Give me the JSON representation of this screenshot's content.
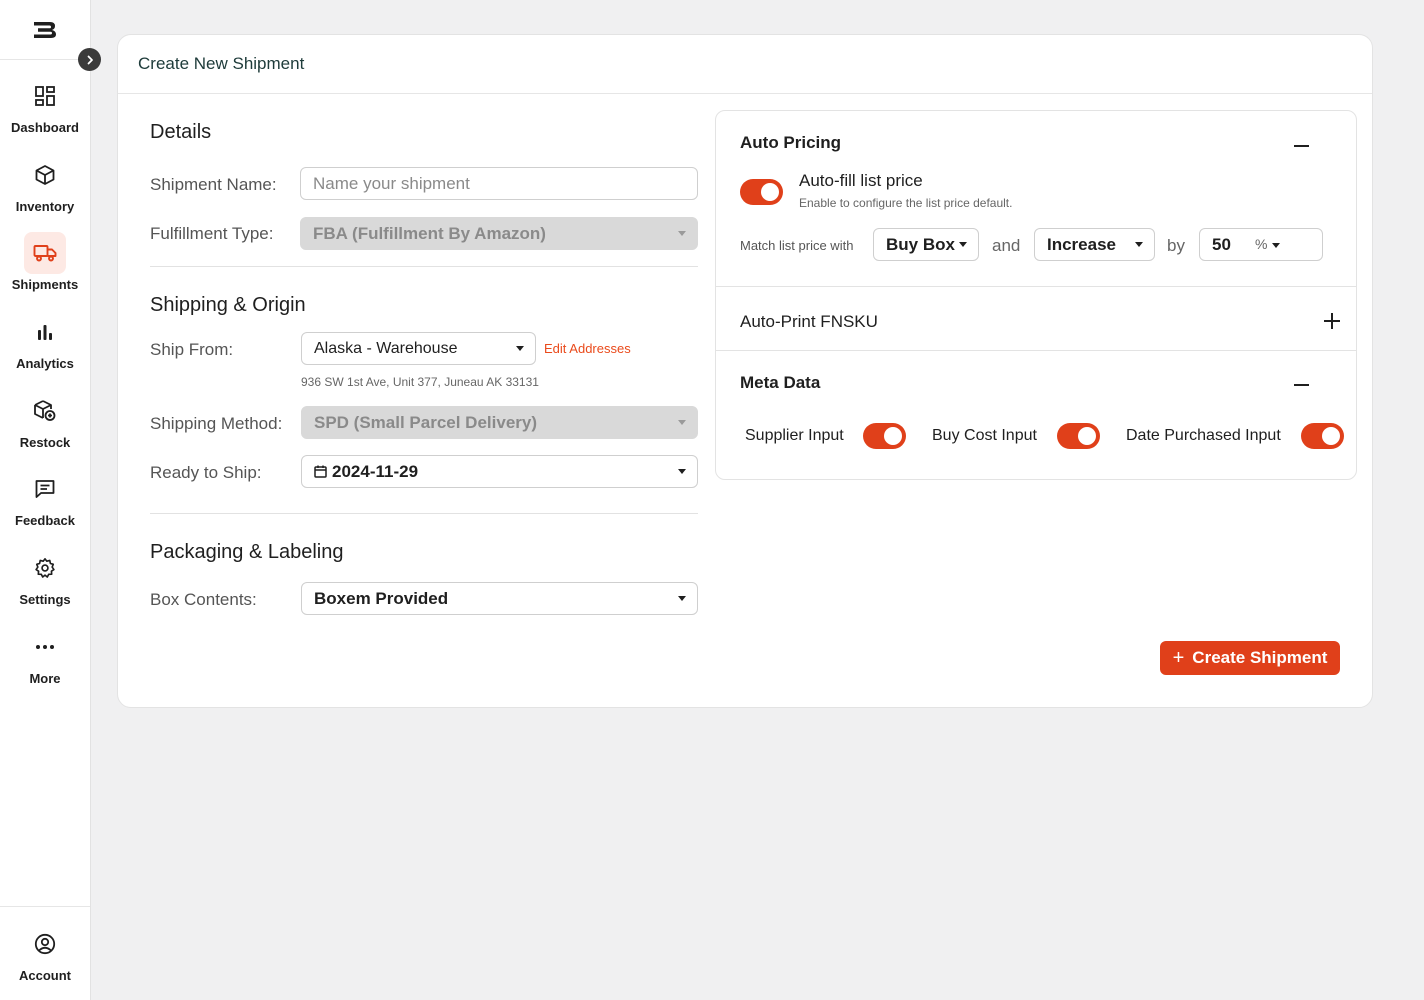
{
  "sidebar": {
    "logo": "B",
    "items": [
      {
        "label": "Dashboard",
        "icon": "dashboard-icon"
      },
      {
        "label": "Inventory",
        "icon": "box-icon"
      },
      {
        "label": "Shipments",
        "icon": "truck-icon"
      },
      {
        "label": "Analytics",
        "icon": "bar-chart-icon"
      },
      {
        "label": "Restock",
        "icon": "restock-icon"
      },
      {
        "label": "Feedback",
        "icon": "message-icon"
      },
      {
        "label": "Settings",
        "icon": "gear-icon"
      },
      {
        "label": "More",
        "icon": "more-icon"
      }
    ],
    "account": {
      "label": "Account",
      "icon": "user-circle-icon"
    },
    "active": "Shipments"
  },
  "page": {
    "title": "Create New Shipment"
  },
  "details": {
    "title": "Details",
    "shipment_name_label": "Shipment Name:",
    "shipment_name_placeholder": "Name your shipment",
    "fulfillment_label": "Fulfillment Type:",
    "fulfillment_value": "FBA (Fulfillment By Amazon)"
  },
  "shipping": {
    "title": "Shipping & Origin",
    "ship_from_label": "Ship From:",
    "ship_from_value": "Alaska - Warehouse",
    "edit_addresses": "Edit Addresses",
    "address": "936 SW 1st Ave, Unit 377, Juneau AK 33131",
    "method_label": "Shipping Method:",
    "method_value": "SPD (Small Parcel Delivery)",
    "ready_label": "Ready to Ship:",
    "ready_value": "2024-11-29"
  },
  "packaging": {
    "title": "Packaging & Labeling",
    "box_contents_label": "Box Contents:",
    "box_contents_value": "Boxem Provided"
  },
  "auto_pricing": {
    "title": "Auto Pricing",
    "toggle_title": "Auto-fill list price",
    "toggle_sub": "Enable to configure the list price default.",
    "match_label": "Match list price with",
    "match_value": "Buy Box",
    "and": "and",
    "direction_value": "Increase",
    "by": "by",
    "amount": "50",
    "unit": "%"
  },
  "auto_print": {
    "title": "Auto-Print FNSKU"
  },
  "meta_data": {
    "title": "Meta Data",
    "supplier_label": "Supplier Input",
    "buy_cost_label": "Buy Cost Input",
    "date_purchased_label": "Date Purchased Input"
  },
  "actions": {
    "create_label": "Create Shipment",
    "create_prefix": "+"
  },
  "colors": {
    "accent": "#e0401a",
    "accent_light": "#fde9e4",
    "title": "#1e3b3a"
  }
}
